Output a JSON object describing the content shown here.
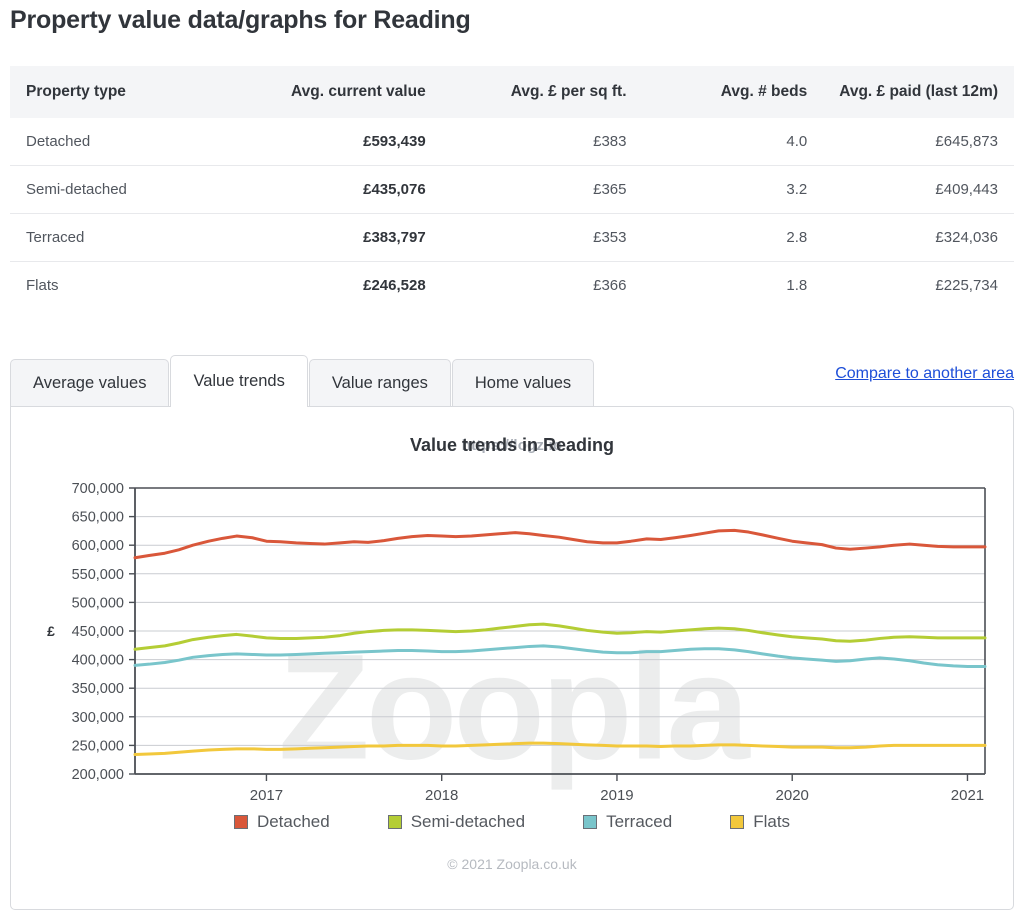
{
  "page": {
    "title": "Property value data/graphs for Reading"
  },
  "table": {
    "columns": [
      "Property type",
      "Avg. current value",
      "Avg. £ per sq ft.",
      "Avg. # beds",
      "Avg. £ paid (last 12m)"
    ],
    "rows": [
      {
        "type": "Detached",
        "current_value": "£593,439",
        "per_sqft": "£383",
        "beds": "4.0",
        "paid_12m": "£645,873"
      },
      {
        "type": "Semi-detached",
        "current_value": "£435,076",
        "per_sqft": "£365",
        "beds": "3.2",
        "paid_12m": "£409,443"
      },
      {
        "type": "Terraced",
        "current_value": "£383,797",
        "per_sqft": "£353",
        "beds": "2.8",
        "paid_12m": "£324,036"
      },
      {
        "type": "Flats",
        "current_value": "£246,528",
        "per_sqft": "£366",
        "beds": "1.8",
        "paid_12m": "£225,734"
      }
    ]
  },
  "tabs": {
    "items": [
      {
        "label": "Average values",
        "active": false
      },
      {
        "label": "Value trends",
        "active": true
      },
      {
        "label": "Value ranges",
        "active": false
      },
      {
        "label": "Home values",
        "active": false
      }
    ],
    "compare_link": "Compare to another area"
  },
  "chart_panel": {
    "title": "Value trends in Reading",
    "title_overlay": "https://logz.io",
    "watermark": "Zoopla",
    "credit": "© 2021 Zoopla.co.uk"
  },
  "chart_data": {
    "type": "line",
    "title": "Value trends in Reading",
    "xlabel": "",
    "ylabel": "£",
    "ylim": [
      200000,
      700000
    ],
    "ytick_labels": [
      "200,000",
      "250,000",
      "300,000",
      "350,000",
      "400,000",
      "450,000",
      "500,000",
      "550,000",
      "600,000",
      "650,000",
      "700,000"
    ],
    "yticks": [
      200000,
      250000,
      300000,
      350000,
      400000,
      450000,
      500000,
      550000,
      600000,
      650000,
      700000
    ],
    "xlim": [
      2016.25,
      2021.1
    ],
    "xticks": [
      2017,
      2018,
      2019,
      2020,
      2021
    ],
    "xtick_labels": [
      "2017",
      "2018",
      "2019",
      "2020",
      "2021"
    ],
    "grid": true,
    "legend_position": "bottom",
    "x": [
      2016.25,
      2016.33,
      2016.42,
      2016.5,
      2016.58,
      2016.67,
      2016.75,
      2016.83,
      2016.92,
      2017.0,
      2017.08,
      2017.17,
      2017.25,
      2017.33,
      2017.42,
      2017.5,
      2017.58,
      2017.67,
      2017.75,
      2017.83,
      2017.92,
      2018.0,
      2018.08,
      2018.17,
      2018.25,
      2018.33,
      2018.42,
      2018.5,
      2018.58,
      2018.67,
      2018.75,
      2018.83,
      2018.92,
      2019.0,
      2019.08,
      2019.17,
      2019.25,
      2019.33,
      2019.42,
      2019.5,
      2019.58,
      2019.67,
      2019.75,
      2019.83,
      2019.92,
      2020.0,
      2020.08,
      2020.17,
      2020.25,
      2020.33,
      2020.42,
      2020.5,
      2020.58,
      2020.67,
      2020.75,
      2020.83,
      2020.92,
      2021.0,
      2021.1
    ],
    "series": [
      {
        "name": "Detached",
        "color": "#d9573a",
        "values": [
          578000,
          582000,
          586000,
          592000,
          600000,
          607000,
          612000,
          616000,
          613000,
          607000,
          606000,
          604000,
          603000,
          602000,
          604000,
          606000,
          605000,
          608000,
          612000,
          615000,
          617000,
          616000,
          615000,
          616000,
          618000,
          620000,
          622000,
          620000,
          617000,
          614000,
          610000,
          606000,
          604000,
          604000,
          607000,
          611000,
          610000,
          613000,
          617000,
          621000,
          625000,
          626000,
          623000,
          618000,
          612000,
          607000,
          604000,
          601000,
          595000,
          593000,
          595000,
          597000,
          600000,
          602000,
          600000,
          598000,
          597000,
          597000,
          597000
        ]
      },
      {
        "name": "Semi-detached",
        "color": "#b4cd35",
        "values": [
          418000,
          421000,
          424000,
          429000,
          435000,
          439000,
          442000,
          444000,
          441000,
          438000,
          437000,
          437000,
          438000,
          439000,
          442000,
          446000,
          449000,
          451000,
          452000,
          452000,
          451000,
          450000,
          449000,
          450000,
          452000,
          455000,
          458000,
          461000,
          462000,
          459000,
          455000,
          451000,
          448000,
          446000,
          447000,
          449000,
          448000,
          450000,
          452000,
          454000,
          455000,
          454000,
          451000,
          447000,
          443000,
          440000,
          438000,
          436000,
          433000,
          432000,
          434000,
          437000,
          439000,
          440000,
          439000,
          438000,
          438000,
          438000,
          438000
        ]
      },
      {
        "name": "Terraced",
        "color": "#79c5cb",
        "values": [
          390000,
          392000,
          395000,
          399000,
          404000,
          407000,
          409000,
          410000,
          409000,
          408000,
          408000,
          409000,
          410000,
          411000,
          412000,
          413000,
          414000,
          415000,
          416000,
          416000,
          415000,
          414000,
          414000,
          415000,
          417000,
          419000,
          421000,
          423000,
          424000,
          422000,
          419000,
          416000,
          413000,
          412000,
          412000,
          414000,
          414000,
          416000,
          418000,
          419000,
          419000,
          417000,
          414000,
          410000,
          406000,
          403000,
          401000,
          399000,
          397000,
          398000,
          401000,
          403000,
          401000,
          398000,
          394000,
          391000,
          389000,
          388000,
          388000
        ]
      },
      {
        "name": "Flats",
        "color": "#f2c83c",
        "values": [
          234000,
          235000,
          236000,
          238000,
          240000,
          242000,
          243000,
          244000,
          244000,
          243000,
          243000,
          244000,
          245000,
          246000,
          247000,
          248000,
          249000,
          249000,
          250000,
          250000,
          250000,
          249000,
          249000,
          250000,
          251000,
          252000,
          253000,
          254000,
          254000,
          253000,
          252000,
          251000,
          250000,
          249000,
          249000,
          249000,
          248000,
          249000,
          249000,
          250000,
          251000,
          251000,
          250000,
          249000,
          248000,
          247000,
          247000,
          247000,
          246000,
          246000,
          247000,
          249000,
          250000,
          250000,
          250000,
          250000,
          250000,
          250000,
          250000
        ]
      }
    ]
  }
}
